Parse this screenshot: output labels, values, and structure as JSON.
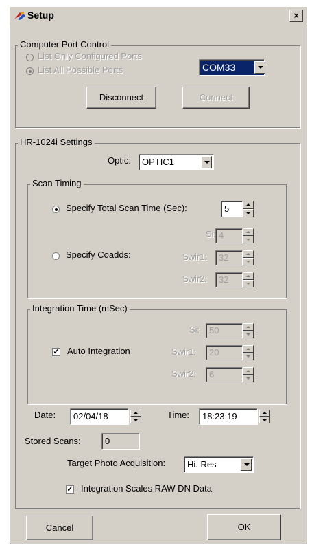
{
  "window": {
    "title": "Setup",
    "close_glyph": "×"
  },
  "port_control": {
    "legend": "Computer Port Control",
    "radio_configured": "List Only Configured Ports",
    "radio_all": "List All Possible Ports",
    "port_value": "COM33",
    "disconnect_label": "Disconnect",
    "connect_label": "Connect"
  },
  "settings": {
    "legend": "HR-1024i Settings",
    "optic_label": "Optic:",
    "optic_value": "OPTIC1"
  },
  "scan_timing": {
    "legend": "Scan Timing",
    "total_time_label": "Specify Total Scan Time (Sec):",
    "total_time_value": "5",
    "coadds_label": "Specify Coadds:",
    "si_label": "Si:",
    "si_value": "4",
    "swir1_label": "Swir1:",
    "swir1_value": "32",
    "swir2_label": "Swir2:",
    "swir2_value": "32"
  },
  "integration": {
    "legend": "Integration Time (mSec)",
    "auto_label": "Auto Integration",
    "si_label": "Si:",
    "si_value": "50",
    "swir1_label": "Swir1:",
    "swir1_value": "20",
    "swir2_label": "Swir2:",
    "swir2_value": "6"
  },
  "datetime": {
    "date_label": "Date:",
    "date_value": "02/04/18",
    "time_label": "Time:",
    "time_value": "18:23:19"
  },
  "stored": {
    "label": "Stored Scans:",
    "value": "0"
  },
  "photo": {
    "label": "Target Photo Acquisition:",
    "value": "Hi. Res"
  },
  "scales": {
    "label": "Integration Scales RAW DN Data"
  },
  "footer": {
    "cancel_label": "Cancel",
    "ok_label": "OK"
  }
}
